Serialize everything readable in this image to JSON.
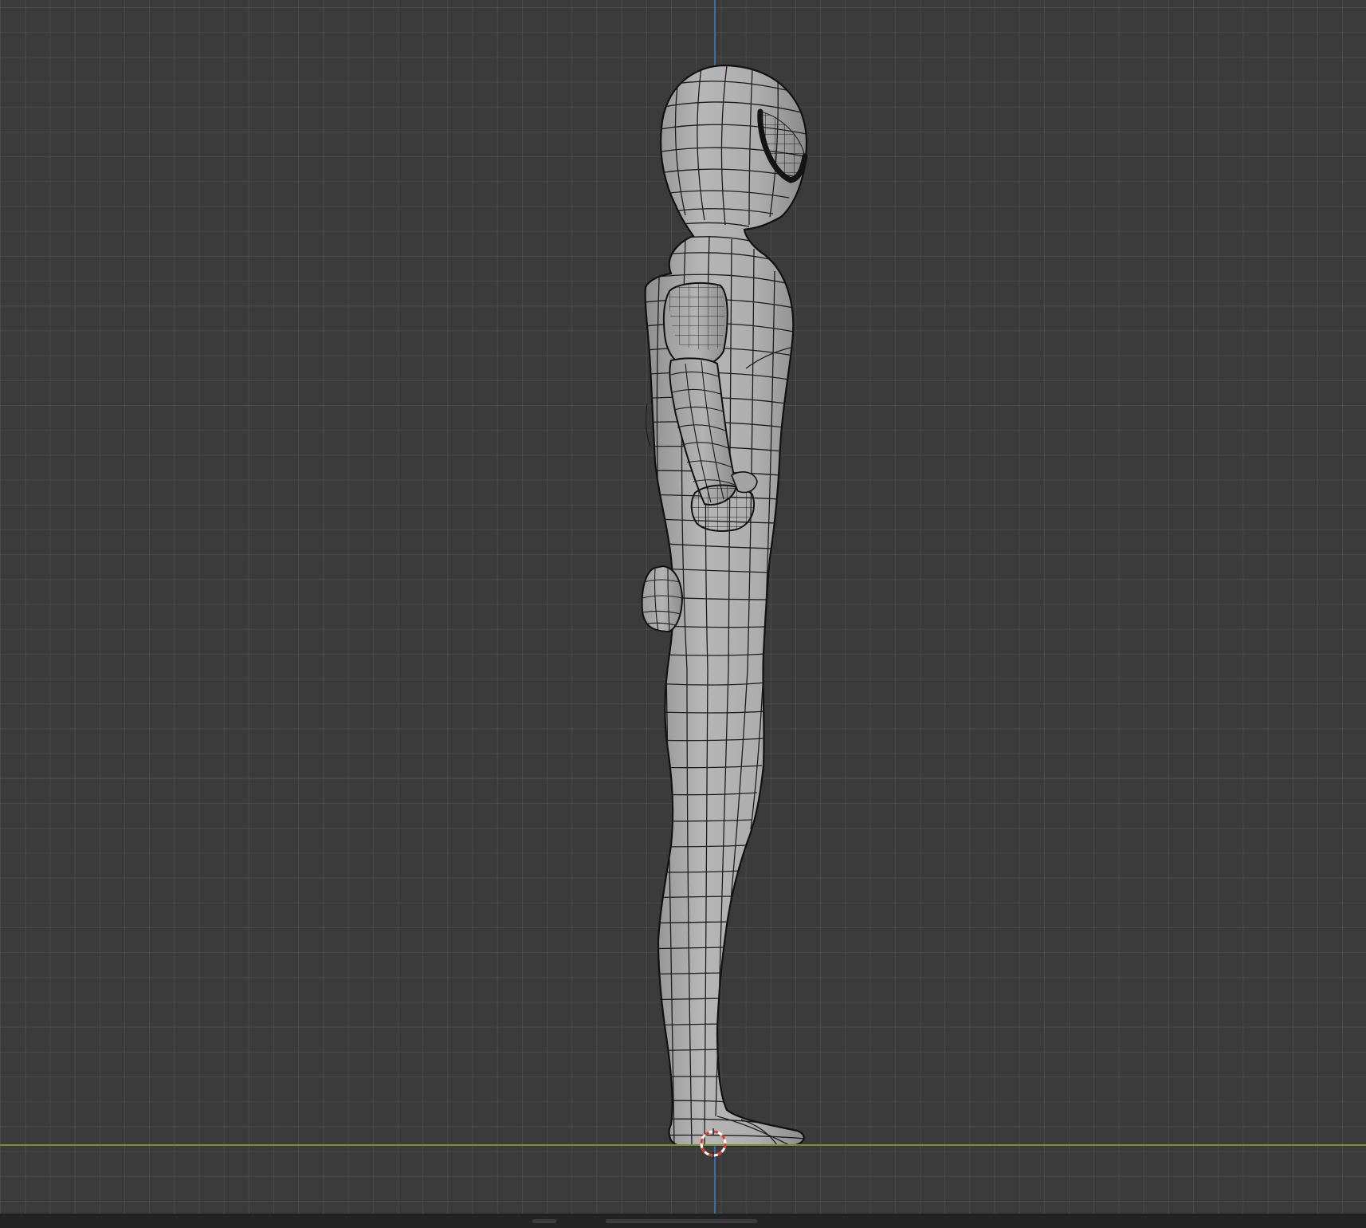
{
  "viewport": {
    "background": "#3b3b3b",
    "grid_color": "#4a4a4a",
    "axis_colors": {
      "z": "#3a6cb0",
      "y": "#7b8f2e"
    }
  },
  "model": {
    "shading": "solid",
    "overlay": "wireframe",
    "surface_color": "#a9a9a9",
    "wire_color": "#1b1b1b"
  },
  "cursor": {
    "icon": "3d-cursor-icon",
    "colors": [
      "#e03a2f",
      "#ffffff"
    ]
  }
}
